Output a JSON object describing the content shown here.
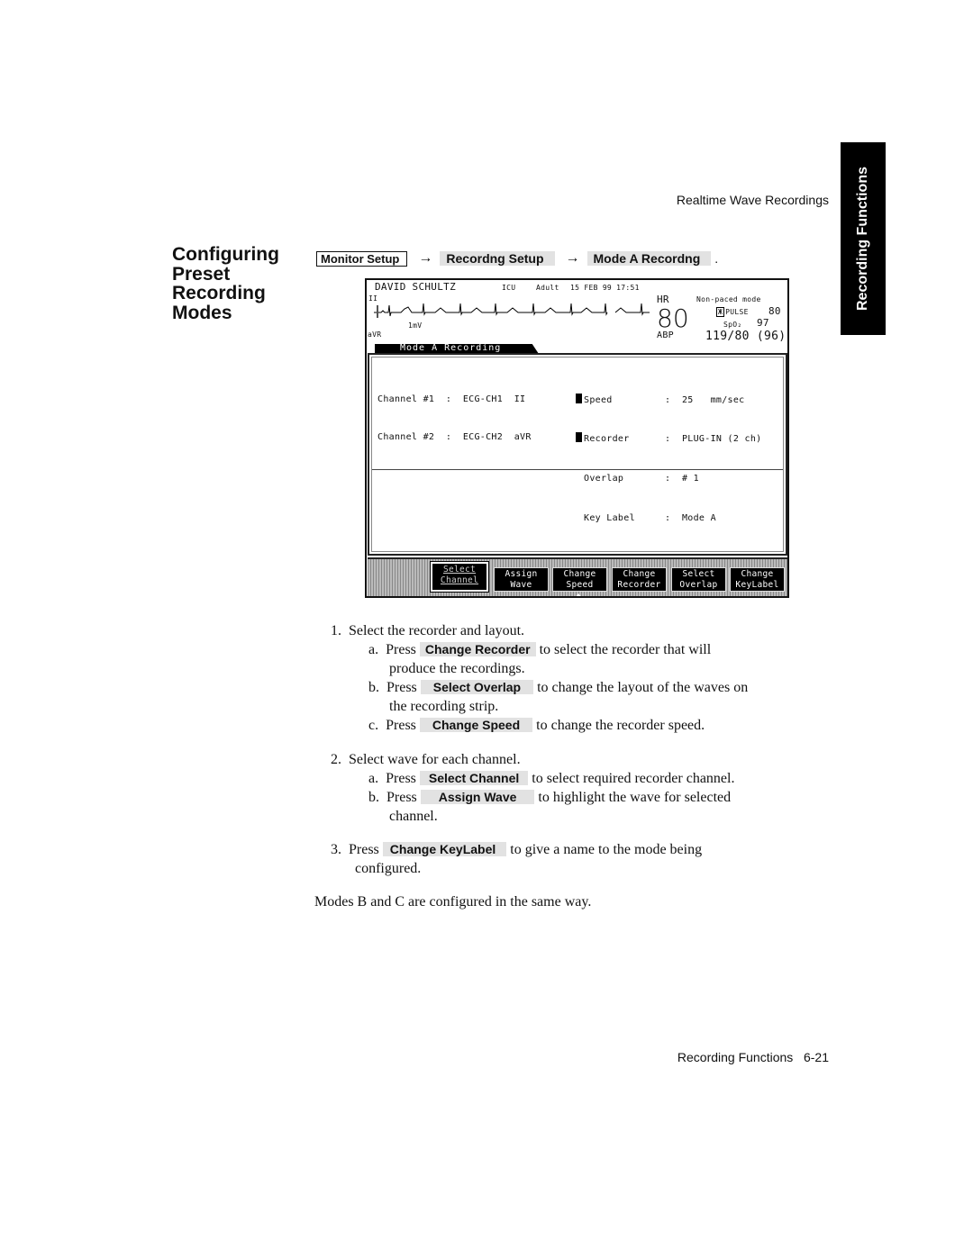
{
  "header": {
    "section_label": "Realtime Wave Recordings"
  },
  "side_tab": {
    "label": "Recording Functions"
  },
  "section_title": [
    "Configuring",
    "Preset",
    "Recording",
    "Modes"
  ],
  "path": {
    "hardkey": "Monitor Setup",
    "arrow": "→",
    "softkey1": "Recordng Setup",
    "softkey2": "Mode A Recordng",
    "end": "."
  },
  "monitor": {
    "patient_name": "DAVID SCHULTZ",
    "unit": "ICU",
    "patient_type": "Adult",
    "datetime": "15 FEB 99 17:51",
    "lead_top": "II",
    "lead_bottom": "aVR",
    "scale": "1mV",
    "hr_label": "HR",
    "hr_value": "80",
    "pace_mode": "Non-paced mode",
    "pulse_label": "PULSE",
    "pulse_value": "80",
    "spo2_label": "SpO₂",
    "spo2_value": "97",
    "abp_label": "ABP",
    "abp_value": "119/80 (96)",
    "window_title": "Mode A Recording",
    "channels": [
      {
        "label": "Channel #1",
        "source": "ECG-CH1",
        "lead": "II"
      },
      {
        "label": "Channel #2",
        "source": "ECG-CH2",
        "lead": "aVR"
      }
    ],
    "settings": [
      {
        "label": "Speed",
        "value": "25   mm/sec",
        "marked": true
      },
      {
        "label": "Recorder",
        "value": "PLUG-IN (2 ch)",
        "marked": true
      },
      {
        "label": "Overlap",
        "value": "# 1",
        "marked": false
      },
      {
        "label": "Key Label",
        "value": "Mode A",
        "marked": false
      }
    ],
    "softkeys": [
      {
        "line1": "Select",
        "line2": "Channel",
        "selected": true
      },
      {
        "line1": "Assign",
        "line2": "Wave",
        "selected": false
      },
      {
        "line1": "Change",
        "line2": "Speed",
        "selected": false
      },
      {
        "line1": "Change",
        "line2": "Recorder",
        "selected": false
      },
      {
        "line1": "Select",
        "line2": "Overlap",
        "selected": false
      },
      {
        "line1": "Change",
        "line2": "KeyLabel",
        "selected": false
      }
    ]
  },
  "steps": {
    "s1": {
      "num": "1.",
      "text": "Select the recorder and layout."
    },
    "s1a": {
      "letter": "a.",
      "press": "Press",
      "key": "Change Recorder",
      "text": "to select the recorder that will",
      "cont": "produce the recordings."
    },
    "s1b": {
      "letter": "b.",
      "press": "Press",
      "key": "Select Overlap",
      "text": "to change the layout of the waves on",
      "cont": "the recording strip."
    },
    "s1c": {
      "letter": "c.",
      "press": "Press",
      "key": "Change Speed",
      "text": "to change the recorder speed."
    },
    "s2": {
      "num": "2.",
      "text": "Select wave for each channel."
    },
    "s2a": {
      "letter": "a.",
      "press": "Press",
      "key": "Select Channel",
      "text": "to select required recorder channel."
    },
    "s2b": {
      "letter": "b.",
      "press": "Press",
      "key": "Assign Wave",
      "text": "to highlight the wave for selected",
      "cont": "channel."
    },
    "s3": {
      "num": "3.",
      "press": "Press",
      "key": "Change KeyLabel",
      "text": "to give a name to the mode being",
      "cont": "configured."
    },
    "note": "Modes B and C are configured in the same way."
  },
  "footer": {
    "chapter": "Recording Functions",
    "page": "6-21"
  }
}
